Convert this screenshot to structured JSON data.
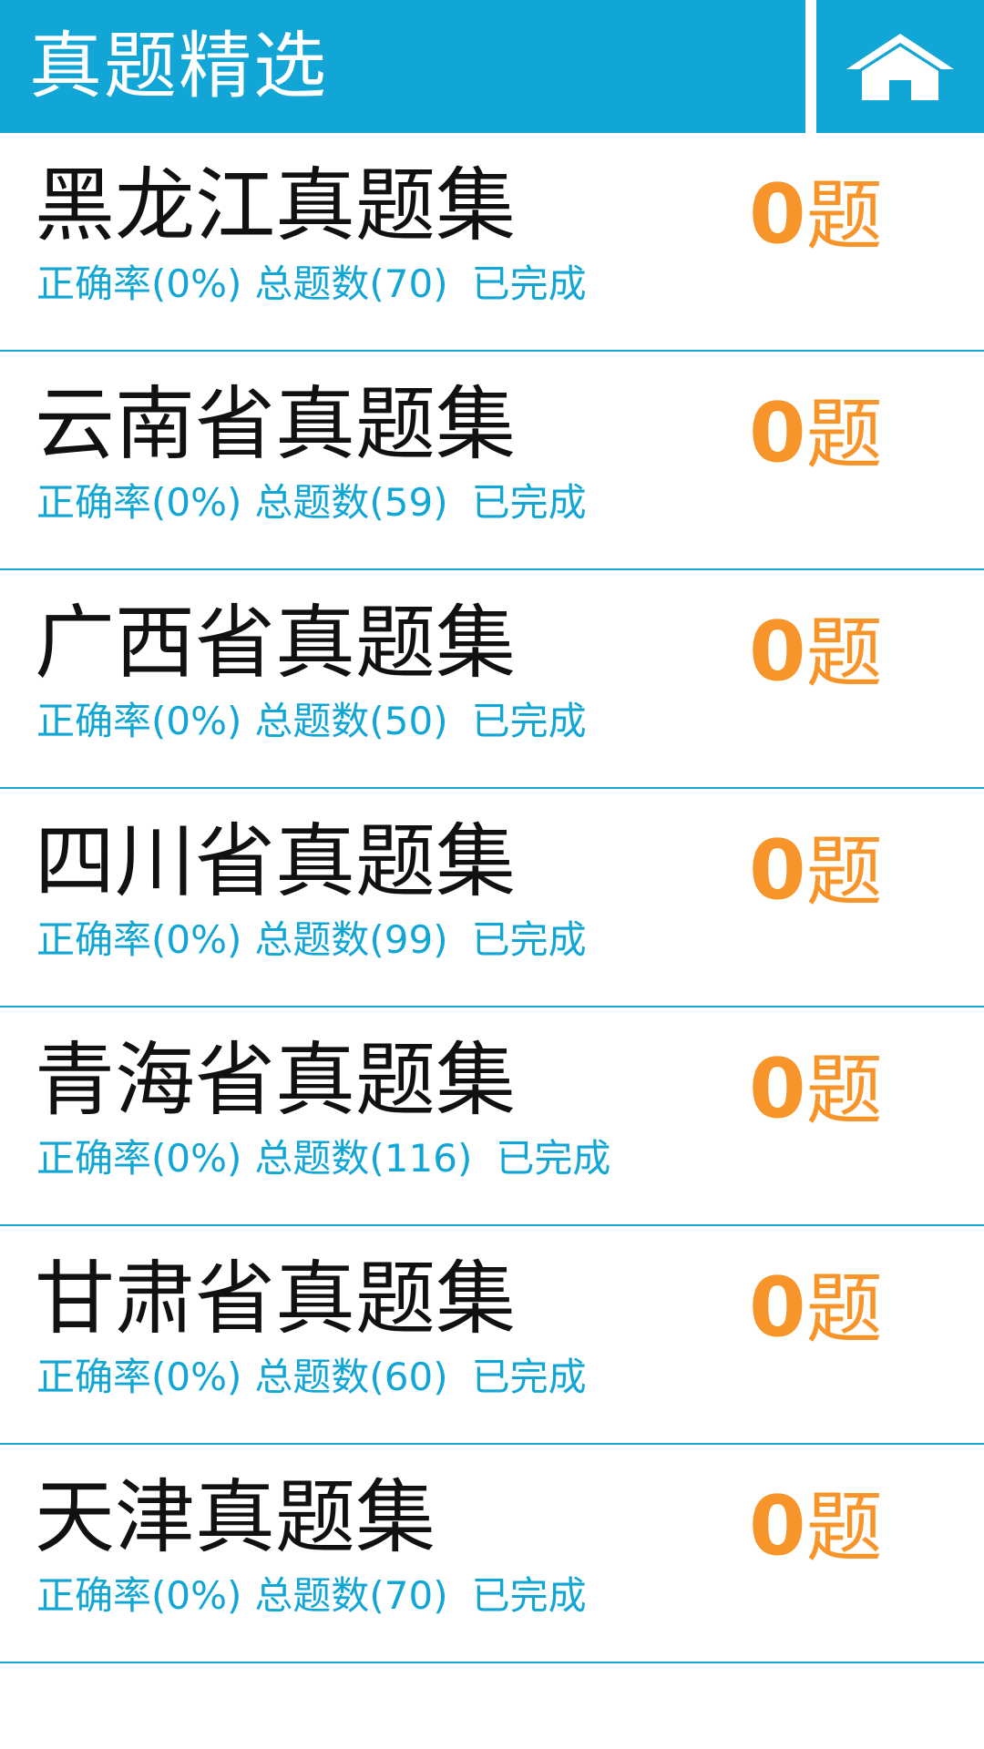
{
  "header": {
    "title": "真题精选",
    "home_icon": "home-icon"
  },
  "colors": {
    "accent": "#12a6d6",
    "count": "#f7952b",
    "title_text": "#111111"
  },
  "items": [
    {
      "title": "黑龙江真题集",
      "accuracy": "正确率(0%)",
      "total": "总题数(70)",
      "status": "已完成",
      "count": "0",
      "unit": "题"
    },
    {
      "title": "云南省真题集",
      "accuracy": "正确率(0%)",
      "total": "总题数(59)",
      "status": "已完成",
      "count": "0",
      "unit": "题"
    },
    {
      "title": "广西省真题集",
      "accuracy": "正确率(0%)",
      "total": "总题数(50)",
      "status": "已完成",
      "count": "0",
      "unit": "题"
    },
    {
      "title": "四川省真题集",
      "accuracy": "正确率(0%)",
      "total": "总题数(99)",
      "status": "已完成",
      "count": "0",
      "unit": "题"
    },
    {
      "title": "青海省真题集",
      "accuracy": "正确率(0%)",
      "total": "总题数(116)",
      "status": "已完成",
      "count": "0",
      "unit": "题"
    },
    {
      "title": "甘肃省真题集",
      "accuracy": "正确率(0%)",
      "total": "总题数(60)",
      "status": "已完成",
      "count": "0",
      "unit": "题"
    },
    {
      "title": "天津真题集",
      "accuracy": "正确率(0%)",
      "total": "总题数(70)",
      "status": "已完成",
      "count": "0",
      "unit": "题"
    }
  ]
}
